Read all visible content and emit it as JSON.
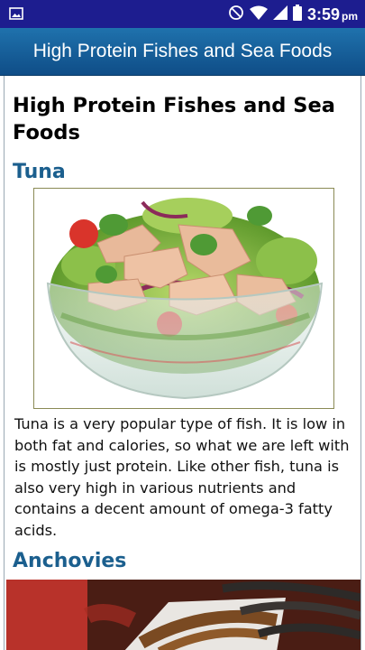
{
  "status_bar": {
    "time": "3:59",
    "ampm": "pm",
    "icons": [
      "gallery-notification-icon",
      "do-not-disturb-icon",
      "wifi-icon",
      "signal-icon",
      "battery-icon"
    ]
  },
  "app_bar": {
    "title": "High Protein Fishes and Sea Foods"
  },
  "article": {
    "title": "High Protein Fishes and Sea Foods",
    "sections": [
      {
        "heading": "Tuna",
        "image": "tuna-salad-bowl",
        "body": "Tuna is a very popular type of fish. It is low in both fat and calories, so what we are left with is mostly just protein. Like other fish, tuna is also very high in various nutrients and contains a decent amount of omega-3 fatty acids."
      },
      {
        "heading": "Anchovies",
        "image": "anchovies-photo"
      }
    ]
  },
  "colors": {
    "status_bar": "#1d1d8f",
    "app_bar": "#1565a0",
    "heading": "#1b5f8e"
  }
}
